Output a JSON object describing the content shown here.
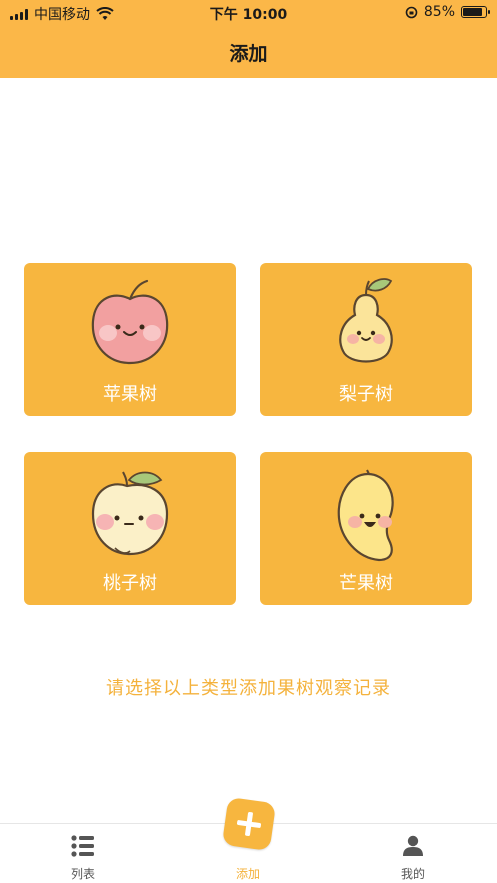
{
  "status_bar": {
    "carrier": "中国移动",
    "time": "下午 10:00",
    "battery_percent": "85%",
    "battery_level": 0.85
  },
  "nav": {
    "title": "添加"
  },
  "cards": [
    {
      "label": "苹果树",
      "icon": "apple-icon"
    },
    {
      "label": "梨子树",
      "icon": "pear-icon"
    },
    {
      "label": "桃子树",
      "icon": "peach-icon"
    },
    {
      "label": "芒果树",
      "icon": "mango-icon"
    }
  ],
  "hint": "请选择以上类型添加果树观察记录",
  "tabs": [
    {
      "label": "列表",
      "icon": "list-icon"
    },
    {
      "label": "添加",
      "icon": "plus-icon"
    },
    {
      "label": "我的",
      "icon": "user-icon"
    }
  ],
  "colors": {
    "brand": "#fbb748",
    "card": "#f7b63f",
    "accent_text": "#f4b23c"
  }
}
